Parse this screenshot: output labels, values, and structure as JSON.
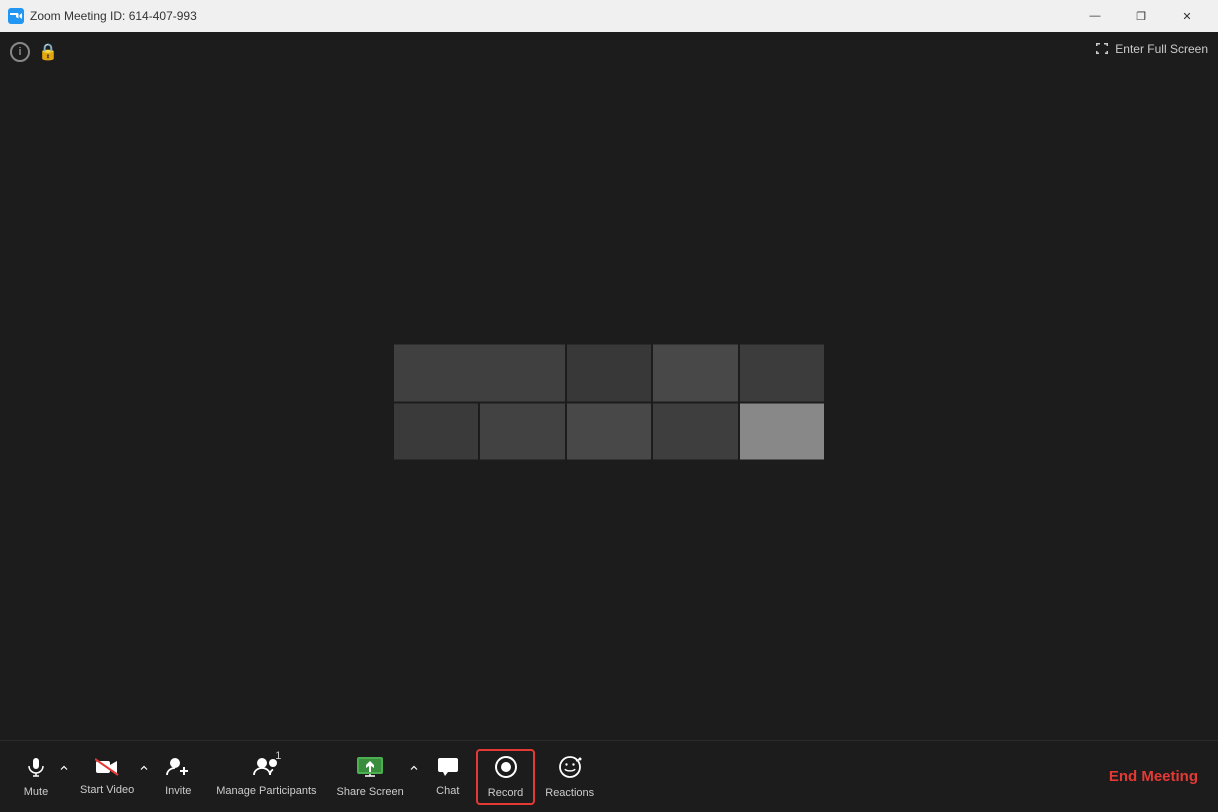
{
  "titleBar": {
    "appName": "Zoom",
    "meetingLabel": "Meeting ID: 614-407-993",
    "fullTitle": "Zoom Meeting ID: 614-407-993",
    "minimizeLabel": "—",
    "restoreLabel": "❐",
    "closeLabel": "✕"
  },
  "topBar": {
    "fullscreenLabel": "Enter Full Screen"
  },
  "toolbar": {
    "muteLabel": "Mute",
    "startVideoLabel": "Start Video",
    "inviteLabel": "Invite",
    "manageParticipantsLabel": "Manage Participants",
    "participantCount": "1",
    "shareScreenLabel": "Share Screen",
    "chatLabel": "Chat",
    "recordLabel": "Record",
    "reactionsLabel": "Reactions",
    "endMeetingLabel": "End Meeting"
  },
  "colors": {
    "accent": "#4caf50",
    "danger": "#e53935",
    "toolbarBg": "#1c1c1c",
    "titleBarBg": "#f0f0f0"
  }
}
